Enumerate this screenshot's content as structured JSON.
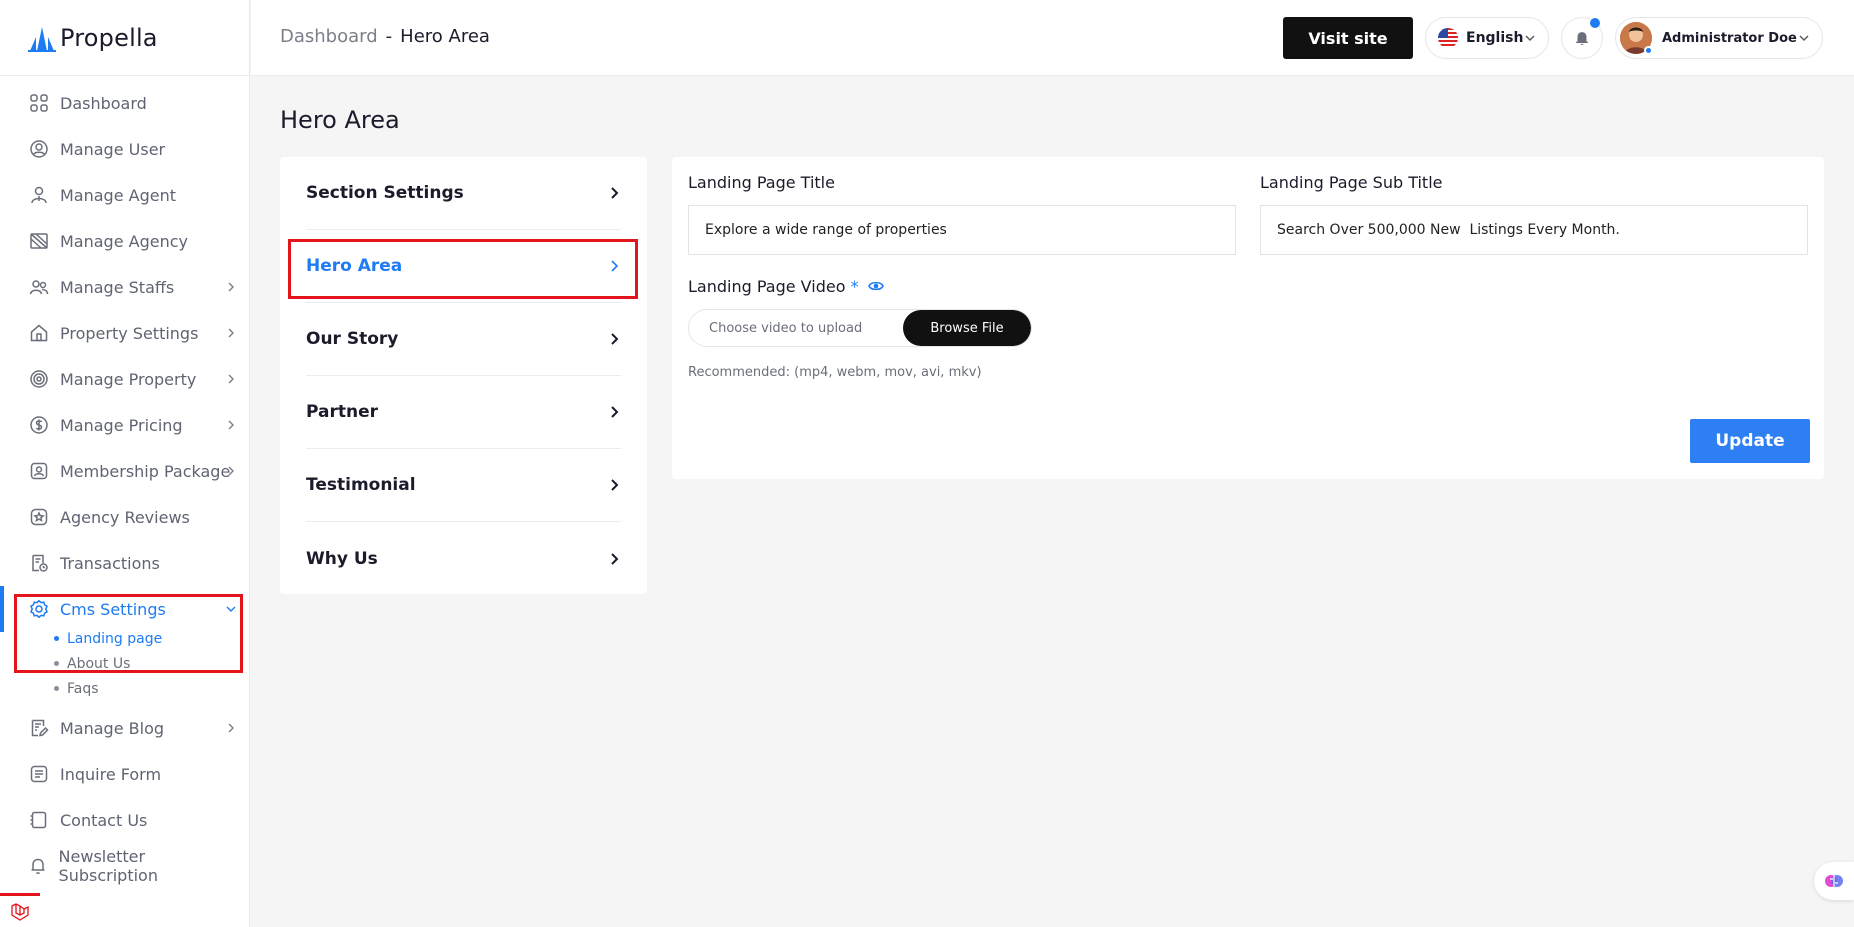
{
  "brand": {
    "name": "Propella"
  },
  "sidebar": {
    "items": [
      {
        "label": "Dashboard",
        "icon": "grid-icon",
        "chevron": false
      },
      {
        "label": "Manage User",
        "icon": "user-circle-icon",
        "chevron": false
      },
      {
        "label": "Manage Agent",
        "icon": "agent-icon",
        "chevron": false
      },
      {
        "label": "Manage Agency",
        "icon": "agency-icon",
        "chevron": false
      },
      {
        "label": "Manage Staffs",
        "icon": "staff-icon",
        "chevron": true
      },
      {
        "label": "Property Settings",
        "icon": "home-icon",
        "chevron": true
      },
      {
        "label": "Manage Property",
        "icon": "settings-ring-icon",
        "chevron": true
      },
      {
        "label": "Manage Pricing",
        "icon": "dollar-icon",
        "chevron": true
      },
      {
        "label": "Membership Package",
        "icon": "badge-icon",
        "chevron": true
      },
      {
        "label": "Agency Reviews",
        "icon": "star-icon",
        "chevron": false
      },
      {
        "label": "Transactions",
        "icon": "receipt-icon",
        "chevron": false
      },
      {
        "label": "Cms Settings",
        "icon": "gear-icon",
        "chevron": true,
        "active": true
      },
      {
        "label": "Manage Blog",
        "icon": "blog-icon",
        "chevron": true
      },
      {
        "label": "Inquire Form",
        "icon": "form-icon",
        "chevron": false
      },
      {
        "label": "Contact Us",
        "icon": "contact-icon",
        "chevron": false
      },
      {
        "label": "Newsletter Subscription",
        "icon": "bell-icon",
        "chevron": false
      }
    ],
    "cms_sub": [
      {
        "label": "Landing page",
        "active": true
      },
      {
        "label": "About Us",
        "active": false
      },
      {
        "label": "Faqs",
        "active": false
      }
    ]
  },
  "header": {
    "breadcrumb_root": "Dashboard",
    "breadcrumb_sep": "-",
    "breadcrumb_current": "Hero Area",
    "visit_site": "Visit site",
    "language": "English",
    "user_name": "Administrator Doe"
  },
  "main": {
    "page_title": "Hero Area",
    "menu": [
      {
        "label": "Section Settings",
        "active": false
      },
      {
        "label": "Hero Area",
        "active": true
      },
      {
        "label": "Our Story",
        "active": false
      },
      {
        "label": "Partner",
        "active": false
      },
      {
        "label": "Testimonial",
        "active": false
      },
      {
        "label": "Why Us",
        "active": false
      }
    ],
    "form": {
      "title_label": "Landing Page Title",
      "title_value": "Explore a wide range of properties",
      "subtitle_label": "Landing Page Sub Title",
      "subtitle_value": "Search Over 500,000 New  Listings Every Month.",
      "video_label": "Landing Page Video",
      "required_mark": "*",
      "video_placeholder": "Choose video to upload",
      "browse_label": "Browse File",
      "hint": "Recommended: (mp4, webm, mov, avi, mkv)",
      "update_label": "Update"
    }
  },
  "colors": {
    "accent": "#1e7bf2",
    "highlight": "#e3141b",
    "dark": "#111111"
  }
}
